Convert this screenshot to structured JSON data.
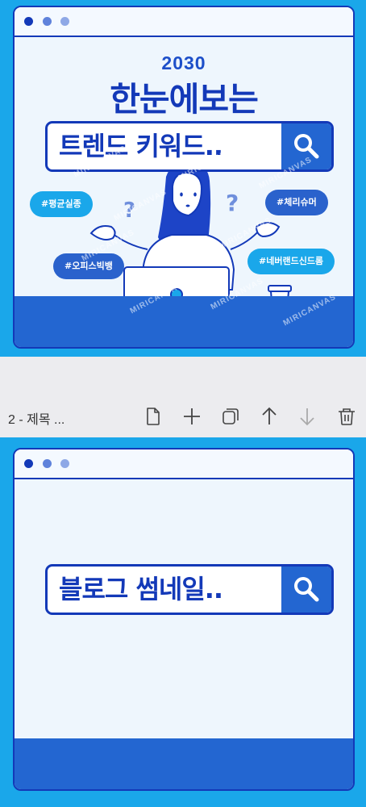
{
  "page1": {
    "year": "2030",
    "headline": "한눈에보는",
    "search_text": "트렌드 키워드..",
    "tags": [
      "#평균실종",
      "#체리슈머",
      "#오피스빅뱅",
      "#네버랜드신드롬"
    ],
    "watermark": "MIRICANVAS"
  },
  "toolbar": {
    "page_label": "2 - 제목 ..."
  },
  "page2": {
    "search_text": "블로그 썸네일.."
  },
  "colors": {
    "frame": "#1aa7ea",
    "navy": "#1339b8",
    "blue": "#2366d1",
    "window_bg": "#eef6fd"
  }
}
